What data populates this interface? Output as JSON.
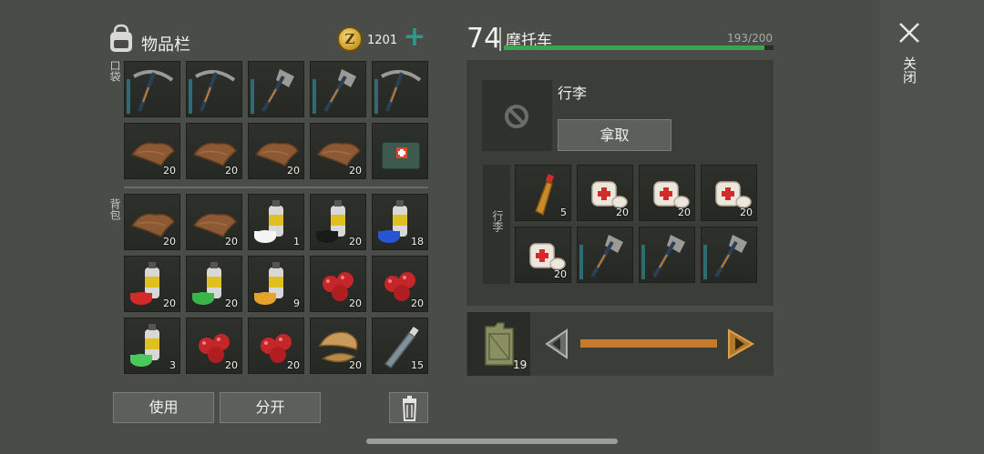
{
  "inventory": {
    "title": "物品栏",
    "coins": "1201",
    "coin_symbol": "Z",
    "plus_label": "+",
    "pocket_label": "口袋",
    "backpack_label": "背包",
    "use_label": "使用",
    "split_label": "分开"
  },
  "pocket_slots": [
    {
      "item": "pickaxe-icon",
      "qty": ""
    },
    {
      "item": "pickaxe-icon",
      "qty": ""
    },
    {
      "item": "hatchet-icon",
      "qty": ""
    },
    {
      "item": "hatchet-icon",
      "qty": ""
    },
    {
      "item": "pickaxe-icon",
      "qty": ""
    },
    {
      "item": "leather-icon",
      "qty": "20"
    },
    {
      "item": "leather-icon",
      "qty": "20"
    },
    {
      "item": "leather-icon",
      "qty": "20"
    },
    {
      "item": "leather-icon",
      "qty": "20"
    },
    {
      "item": "medkit-bag-icon",
      "qty": ""
    }
  ],
  "backpack_slots": [
    {
      "item": "leather-icon",
      "qty": "20"
    },
    {
      "item": "leather-icon",
      "qty": "20"
    },
    {
      "item": "paint-white-icon",
      "qty": "1"
    },
    {
      "item": "paint-black-icon",
      "qty": "20"
    },
    {
      "item": "paint-blue-icon",
      "qty": "18"
    },
    {
      "item": "paint-red-icon",
      "qty": "20"
    },
    {
      "item": "paint-green-icon",
      "qty": "20"
    },
    {
      "item": "paint-yellow-icon",
      "qty": "9"
    },
    {
      "item": "berries-icon",
      "qty": "20"
    },
    {
      "item": "berries-icon",
      "qty": "20"
    },
    {
      "item": "paint-lightgreen-icon",
      "qty": "3"
    },
    {
      "item": "berries-icon",
      "qty": "20"
    },
    {
      "item": "berries-icon",
      "qty": "20"
    },
    {
      "item": "mushroom-icon",
      "qty": "20"
    },
    {
      "item": "bottle-icon",
      "qty": "15"
    }
  ],
  "vehicle": {
    "level": "74",
    "name": "摩托车",
    "capacity": "193/200",
    "capacity_fraction": 0.965,
    "trunk_label": "行李",
    "take_label": "拿取",
    "trunk_tag": "行李",
    "fuel_qty": "19",
    "fuel_fraction": 1.0
  },
  "trunk_slots": [
    {
      "item": "water-bottle-icon",
      "qty": "5"
    },
    {
      "item": "bandage-icon",
      "qty": "20"
    },
    {
      "item": "bandage-icon",
      "qty": "20"
    },
    {
      "item": "bandage-icon",
      "qty": "20"
    },
    {
      "item": "bandage-icon",
      "qty": "20"
    },
    {
      "item": "hatchet-icon",
      "qty": ""
    },
    {
      "item": "hatchet-icon",
      "qty": ""
    },
    {
      "item": "hatchet-icon",
      "qty": ""
    }
  ],
  "close_label": "关闭",
  "colors": {
    "capacity_bar": "#3aa64a",
    "fuel_bar": "#c87a2a",
    "plus": "#2f9a8a"
  }
}
